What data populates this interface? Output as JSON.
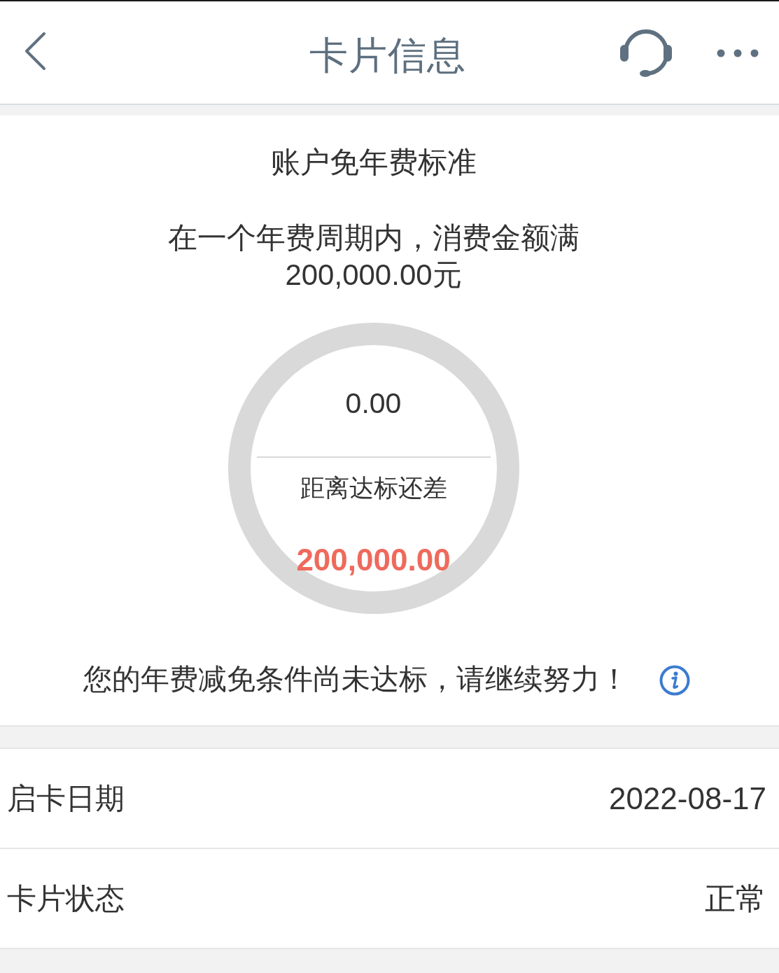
{
  "header": {
    "title": "卡片信息"
  },
  "fee_standard": {
    "title": "账户免年费标准",
    "condition": "在一个年费周期内，消费金额满200,000.00元",
    "progress": {
      "spent": "0.00",
      "remaining_label": "距离达标还差",
      "remaining": "200,000.00"
    },
    "message": "您的年费减免条件尚未达标，请继续努力！"
  },
  "details": [
    {
      "label": "启卡日期",
      "value": "2022-08-17"
    },
    {
      "label": "卡片状态",
      "value": "正常"
    }
  ]
}
